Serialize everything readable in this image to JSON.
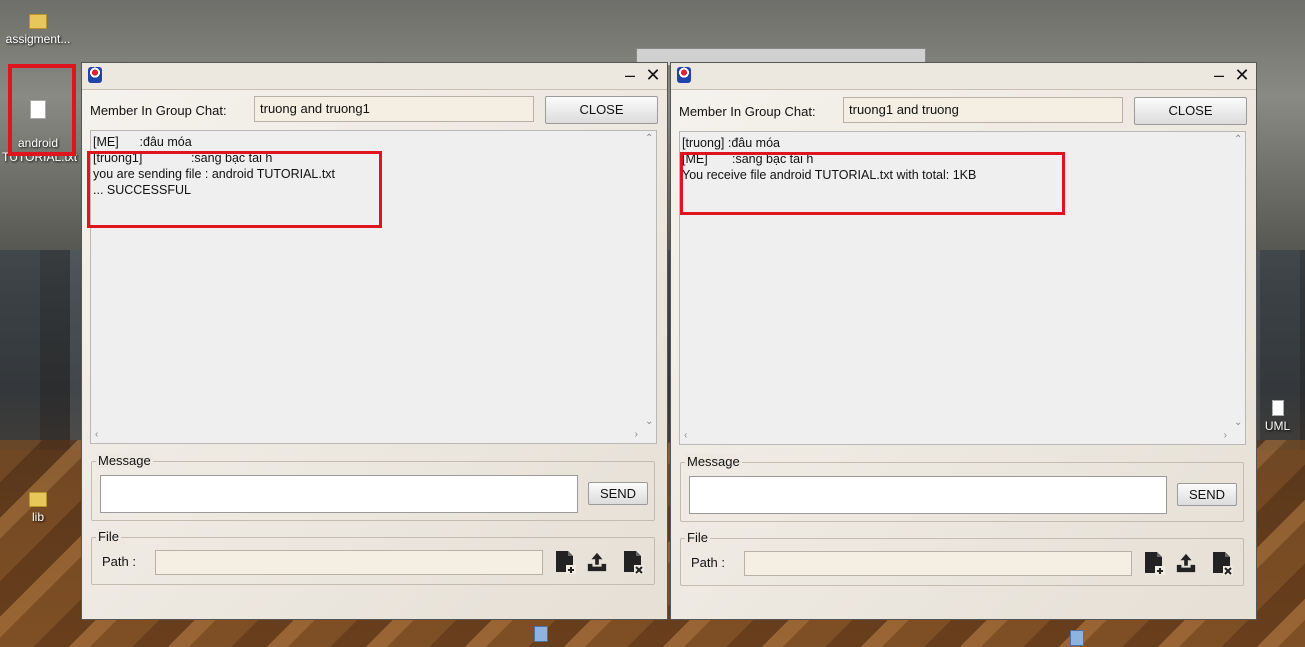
{
  "desktop": {
    "icons": [
      {
        "label": "assigment..."
      },
      {
        "label": "android\nTUTORIAL.txt"
      },
      {
        "label": "lib"
      },
      {
        "label": "UML"
      }
    ]
  },
  "windows": [
    {
      "members_label": "Member In Group Chat:",
      "members_value": "truong and truong1",
      "close_label": "CLOSE",
      "chat_lines": [
        "[ME]      :đâu móa",
        "[truong1]              :sang bạc tai h",
        "you are sending file : android TUTORIAL.txt",
        "... SUCCESSFUL"
      ],
      "message_group_label": "Message",
      "send_label": "SEND",
      "file_group_label": "File",
      "path_label": "Path :"
    },
    {
      "members_label": "Member In Group Chat:",
      "members_value": "truong1 and truong",
      "close_label": "CLOSE",
      "chat_lines": [
        "[truong] :đâu móa",
        "[ME]       :sang bạc tai h",
        "You receive file android TUTORIAL.txt with total: 1KB"
      ],
      "message_group_label": "Message",
      "send_label": "SEND",
      "file_group_label": "File",
      "path_label": "Path :"
    }
  ],
  "colors": {
    "highlight_red": "#e0141e",
    "window_bg": "#f0ece4"
  }
}
